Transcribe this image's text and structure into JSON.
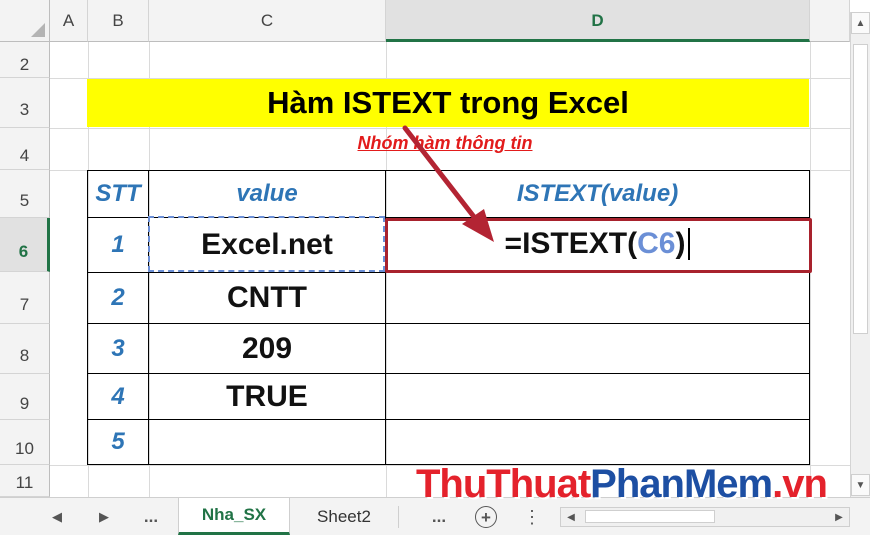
{
  "columns": {
    "a": "A",
    "b": "B",
    "c": "C",
    "d": "D"
  },
  "rows": {
    "r2": "2",
    "r3": "3",
    "r4": "4",
    "r5": "5",
    "r6": "6",
    "r7": "7",
    "r8": "8",
    "r9": "9",
    "r10": "10",
    "r11": "11"
  },
  "title": "Hàm ISTEXT trong Excel",
  "subtitle": "Nhóm hàm thông tin",
  "table": {
    "header_stt": "STT",
    "header_value": "value",
    "header_istext": "ISTEXT(value)",
    "stt": [
      "1",
      "2",
      "3",
      "4",
      "5"
    ],
    "values": [
      "Excel.net",
      "CNTT",
      "209",
      "TRUE",
      ""
    ]
  },
  "formula": {
    "prefix": "=ISTEXT(",
    "ref": "C6",
    "suffix": ")"
  },
  "tabs": {
    "prev_label": "◀",
    "next_label": "▶",
    "more_left": "...",
    "active": "Nha_SX",
    "sheet2": "Sheet2",
    "more_right": "...",
    "add": "+",
    "options": "⋮"
  },
  "watermark": {
    "part1": "ThuThuat",
    "part2": "PhanMem",
    "part3": ".vn"
  },
  "colors": {
    "accent_green": "#217346",
    "title_yellow": "#ffff00",
    "header_blue": "#2e75b6",
    "subtitle_red": "#e21b1b",
    "highlight_red": "#a8222d"
  }
}
